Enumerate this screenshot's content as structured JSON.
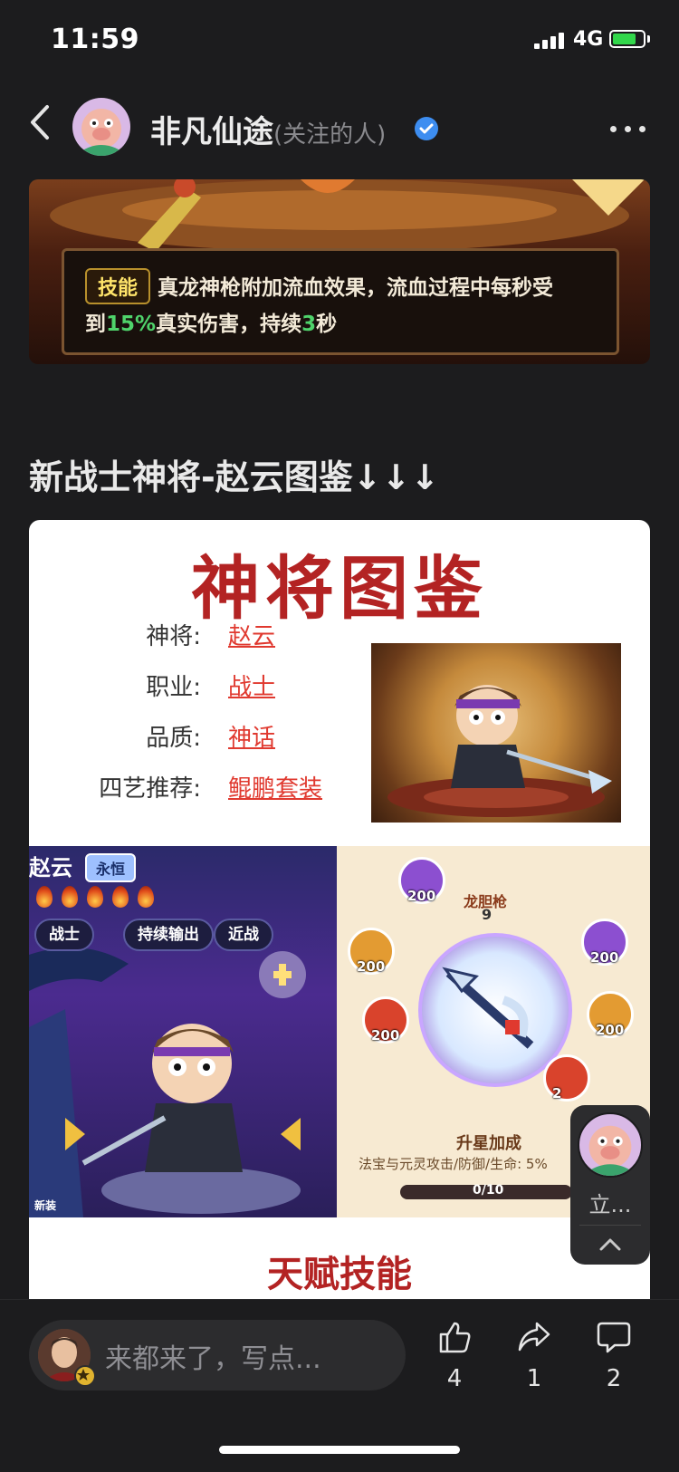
{
  "status_bar": {
    "time": "11:59",
    "network": "4G"
  },
  "nav": {
    "title": "非凡仙途",
    "subtitle": "(关注的人)"
  },
  "skill_card": {
    "tag": "技能",
    "line1": "真龙神枪附加流血效果，流血过程中每秒受",
    "line2_a": "到",
    "line2_pct": "15%",
    "line2_b": "真实伤害，持续",
    "line2_sec": "3",
    "line2_c": "秒"
  },
  "section_heading": "新战士神将-赵云图鉴↓↓↓",
  "hero_card": {
    "title": "神将图鉴",
    "rows": [
      {
        "key": "神将:",
        "value": "赵云"
      },
      {
        "key": "职业:",
        "value": "战士"
      },
      {
        "key": "品质:",
        "value": "神话"
      },
      {
        "key": "四艺推荐:",
        "value": "鲲鹏套装"
      }
    ],
    "game": {
      "hero_name": "赵云",
      "rank": "永恒",
      "tags": [
        "战士",
        "持续输出",
        "近战"
      ],
      "new_label": "新装",
      "weapon_name": "龙胆枪",
      "weapon_level": "9",
      "stats": [
        "200",
        "200",
        "200",
        "200",
        "200",
        "200"
      ],
      "stat_partial": "2",
      "upgrade_title": "升星加成",
      "upgrade_desc": "法宝与元灵攻击/防御/生命: 5%",
      "progress": "0/10"
    },
    "next_heading": "天赋技能"
  },
  "floating_author": {
    "label": "立..."
  },
  "bottom_bar": {
    "comment_placeholder": "来都来了，写点...",
    "likes": "4",
    "shares": "1",
    "comments": "2"
  },
  "colors": {
    "accent_red": "#e0392f",
    "title_red": "#b32323",
    "green_text": "#4fd36b",
    "verified_blue": "#3d8df0"
  }
}
